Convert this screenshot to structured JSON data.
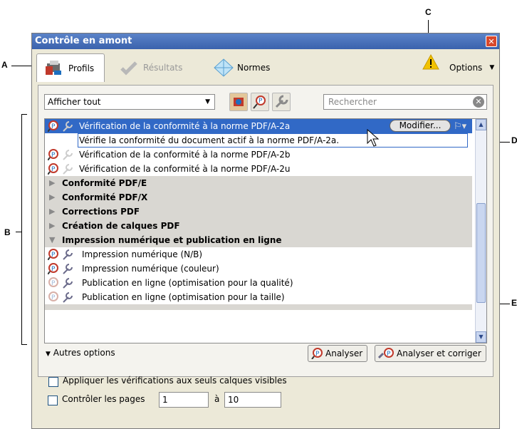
{
  "callouts": {
    "a": "A",
    "b": "B",
    "c": "C",
    "d": "D",
    "e": "E"
  },
  "window": {
    "title": "Contrôle en amont"
  },
  "tabs": [
    {
      "label": "Profils"
    },
    {
      "label": "Résultats"
    },
    {
      "label": "Normes"
    }
  ],
  "options_label": "Options",
  "filter": {
    "selected": "Afficher tout"
  },
  "search": {
    "placeholder": "Rechercher"
  },
  "list": {
    "selected": {
      "label": "Vérification de la conformité à la norme PDF/A-2a",
      "modify": "Modifier..."
    },
    "description": "Vérifie la conformité du document actif à la norme PDF/A-2a.",
    "items_top": [
      "Vérification de la conformité à la norme PDF/A-2b",
      "Vérification de la conformité à la norme PDF/A-2u"
    ],
    "groups": [
      "Conformité PDF/E",
      "Conformité PDF/X",
      "Corrections PDF",
      "Création de calques PDF",
      "Impression numérique et publication en ligne"
    ],
    "items_sub": [
      "Impression numérique (N/B)",
      "Impression numérique (couleur)",
      "Publication en ligne (optimisation pour la qualité)",
      "Publication en ligne (optimisation pour la taille)"
    ]
  },
  "autres_options": "Autres options",
  "buttons": {
    "analyze": "Analyser",
    "analyze_fix": "Analyser et corriger"
  },
  "options_check": {
    "visible_layers": "Appliquer les vérifications aux seuls calques visibles",
    "pages": "Contrôler les pages",
    "page_from": "1",
    "page_to_label": "à",
    "page_to": "10"
  }
}
